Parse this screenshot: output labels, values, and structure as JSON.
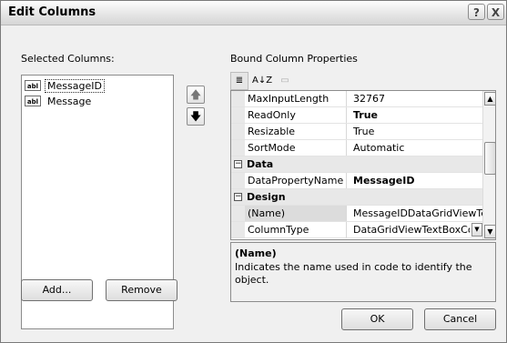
{
  "window": {
    "title": "Edit Columns",
    "help_glyph": "?",
    "close_glyph": "X"
  },
  "selected_columns": {
    "label": "Selected Columns:",
    "items": [
      {
        "icon": "abl",
        "name": "MessageID",
        "selected": true
      },
      {
        "icon": "abl",
        "name": "Message",
        "selected": false
      }
    ],
    "up_glyph": "🡅",
    "down_glyph": "🡇",
    "add_label": "Add...",
    "remove_label": "Remove"
  },
  "properties": {
    "label": "Bound Column Properties",
    "toolbar": {
      "categorized_glyph": "≣",
      "alphabetical_glyph": "A↓Z",
      "pages_glyph": "▭"
    },
    "rows": [
      {
        "type": "prop",
        "name": "MaxInputLength",
        "value": "32767",
        "bold": false
      },
      {
        "type": "prop",
        "name": "ReadOnly",
        "value": "True",
        "bold": true
      },
      {
        "type": "prop",
        "name": "Resizable",
        "value": "True",
        "bold": false
      },
      {
        "type": "prop",
        "name": "SortMode",
        "value": "Automatic",
        "bold": false
      },
      {
        "type": "category",
        "name": "Data",
        "toggle": "−"
      },
      {
        "type": "prop",
        "name": "DataPropertyName",
        "value": "MessageID",
        "bold": true
      },
      {
        "type": "category",
        "name": "Design",
        "toggle": "−"
      },
      {
        "type": "prop",
        "name": "(Name)",
        "value": "MessageIDDataGridViewTe",
        "bold": false
      },
      {
        "type": "prop",
        "name": "ColumnType",
        "value": "DataGridViewTextBoxColu",
        "bold": false,
        "dropdown": true
      }
    ],
    "description": {
      "title": "(Name)",
      "text": "Indicates the name used in code to identify the object."
    }
  },
  "buttons": {
    "ok_label": "OK",
    "cancel_label": "Cancel"
  },
  "colors": {
    "title_bg": "#e4e4e4",
    "dialog_bg": "#f0f0f0",
    "border": "#8c8c8c"
  }
}
